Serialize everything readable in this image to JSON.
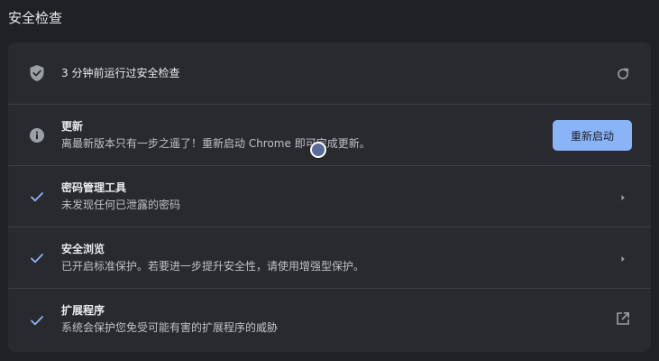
{
  "section": {
    "title": "安全检查"
  },
  "status_row": {
    "title": "3 分钟前运行过安全检查",
    "icon": "shield-check-icon",
    "action_icon": "refresh-icon"
  },
  "rows": [
    {
      "title": "更新",
      "subtitle": "离最新版本只有一步之遥了！重新启动 Chrome 即可完成更新。",
      "icon": "info-icon",
      "button_label": "重新启动"
    },
    {
      "title": "密码管理工具",
      "subtitle": "未发现任何已泄露的密码",
      "icon": "checkmark-icon",
      "action_icon": "chevron-right-icon"
    },
    {
      "title": "安全浏览",
      "subtitle": "已开启标准保护。若要进一步提升安全性，请使用增强型保护。",
      "icon": "checkmark-icon",
      "action_icon": "chevron-right-icon"
    },
    {
      "title": "扩展程序",
      "subtitle": "系统会保护您免受可能有害的扩展程序的威胁",
      "icon": "checkmark-icon",
      "action_icon": "open-in-new-icon"
    }
  ],
  "colors": {
    "background": "#202124",
    "card": "#292a2d",
    "accent": "#8ab4f8",
    "text": "#e8eaed",
    "subtext": "#bdc1c6",
    "icon": "#9aa0a6"
  }
}
